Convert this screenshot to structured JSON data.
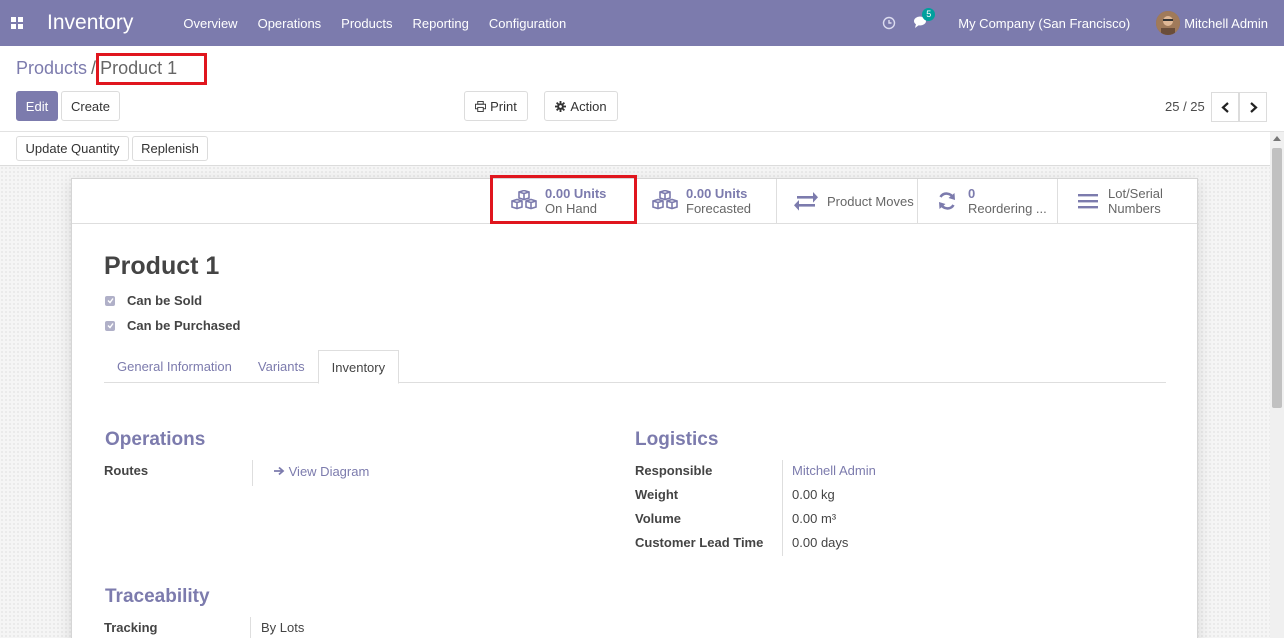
{
  "navbar": {
    "app_name": "Inventory",
    "menu": [
      "Overview",
      "Operations",
      "Products",
      "Reporting",
      "Configuration"
    ],
    "chat_badge": "5",
    "company": "My Company (San Francisco)",
    "user": "Mitchell Admin",
    "background": "#7c7bad"
  },
  "breadcrumb": {
    "parent": "Products",
    "separator": "/",
    "current": "Product 1"
  },
  "toolbar": {
    "edit": "Edit",
    "create": "Create",
    "print": "Print",
    "action": "Action",
    "pager": "25 / 25"
  },
  "statusbar": {
    "update_quantity": "Update Quantity",
    "replenish": "Replenish"
  },
  "stat_buttons": {
    "on_hand_value": "0.00 Units",
    "on_hand_label": "On Hand",
    "forecasted_value": "0.00 Units",
    "forecasted_label": "Forecasted",
    "product_moves": "Product Moves",
    "reordering_value": "0",
    "reordering_label": "Reordering ...",
    "lot_line1": "Lot/Serial",
    "lot_line2": "Numbers"
  },
  "product": {
    "name": "Product 1",
    "can_be_sold": "Can be Sold",
    "can_be_purchased": "Can be Purchased"
  },
  "tabs": [
    "General Information",
    "Variants",
    "Inventory"
  ],
  "operations": {
    "title": "Operations",
    "routes_label": "Routes",
    "view_diagram": "View Diagram"
  },
  "logistics": {
    "title": "Logistics",
    "responsible_label": "Responsible",
    "responsible_value": "Mitchell Admin",
    "weight_label": "Weight",
    "weight_value": "0.00",
    "weight_unit": "kg",
    "volume_label": "Volume",
    "volume_value": "0.00",
    "volume_unit": "m³",
    "lead_label": "Customer Lead Time",
    "lead_value": "0.00",
    "lead_unit": "days"
  },
  "traceability": {
    "title": "Traceability",
    "tracking_label": "Tracking",
    "tracking_value": "By Lots"
  },
  "highlight_color": "#e0161e"
}
